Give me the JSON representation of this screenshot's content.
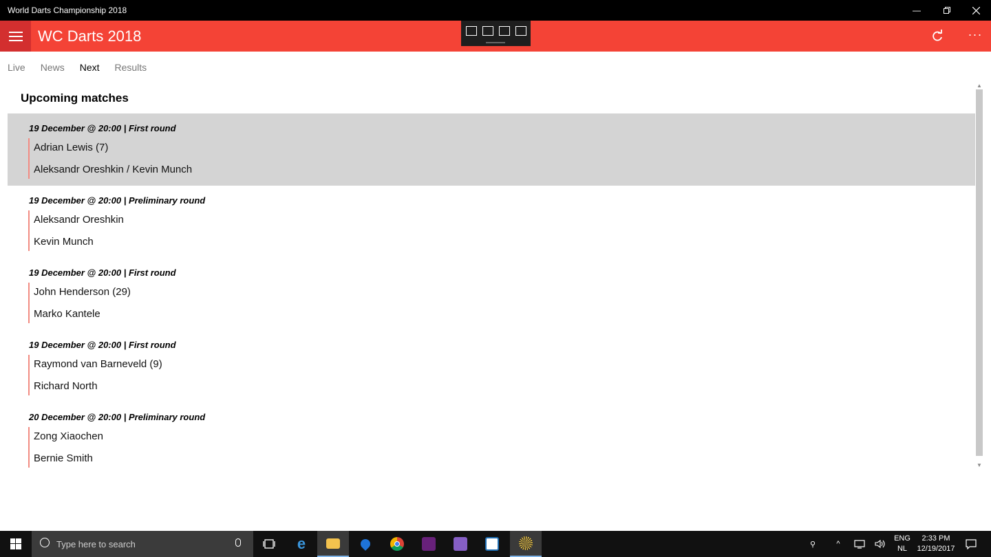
{
  "window": {
    "title": "World Darts Championship 2018"
  },
  "app": {
    "title": "WC Darts 2018"
  },
  "tabs": [
    {
      "label": "Live"
    },
    {
      "label": "News"
    },
    {
      "label": "Next",
      "active": true
    },
    {
      "label": "Results"
    }
  ],
  "section": {
    "heading": "Upcoming matches"
  },
  "matches": [
    {
      "meta": "19 December @ 20:00 | First round",
      "player1": "Adrian Lewis (7)",
      "player2": "Aleksandr Oreshkin / Kevin Munch",
      "selected": true
    },
    {
      "meta": "19 December @ 20:00 | Preliminary round",
      "player1": "Aleksandr Oreshkin",
      "player2": "Kevin Munch"
    },
    {
      "meta": "19 December @ 20:00 | First round",
      "player1": "John Henderson (29)",
      "player2": "Marko Kantele"
    },
    {
      "meta": "19 December @ 20:00 | First round",
      "player1": "Raymond van Barneveld (9)",
      "player2": "Richard North"
    },
    {
      "meta": "20 December @ 20:00 | Preliminary round",
      "player1": "Zong Xiaochen",
      "player2": "Bernie Smith"
    }
  ],
  "taskbar": {
    "search_placeholder": "Type here to search",
    "lang_line1": "ENG",
    "lang_line2": "NL",
    "time": "2:33 PM",
    "date": "12/19/2017"
  },
  "colors": {
    "accent": "#f44336",
    "accent_dark": "#d32f2f",
    "match_bar": "#f28b82",
    "selected_bg": "#d4d4d4"
  },
  "icons": [
    "hamburger-icon",
    "refresh-icon",
    "more-icon",
    "minimize-icon",
    "restore-icon",
    "close-icon",
    "windows-start-icon",
    "search-icon",
    "microphone-icon"
  ]
}
